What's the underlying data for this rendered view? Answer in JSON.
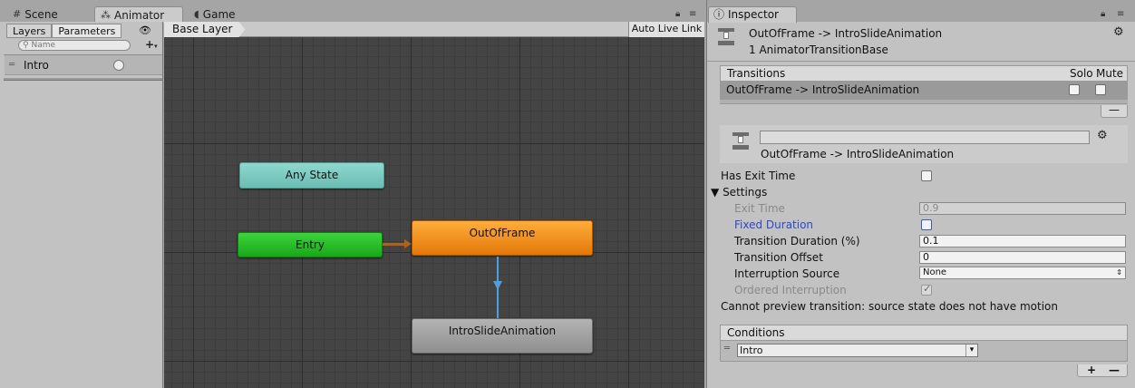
{
  "left_window": {
    "tabs": [
      {
        "label": "Scene",
        "icon": "grid-icon"
      },
      {
        "label": "Animator",
        "icon": "animator-icon"
      },
      {
        "label": "Game",
        "icon": "pacman-icon"
      }
    ],
    "active_tab": "Animator"
  },
  "params_panel": {
    "tabs": [
      "Layers",
      "Parameters"
    ],
    "selected_tab": "Parameters",
    "search_placeholder": "Name",
    "parameters": [
      {
        "name": "Intro",
        "type": "trigger"
      }
    ]
  },
  "graph": {
    "breadcrumb": "Base Layer",
    "live_link_label": "Auto Live Link",
    "nodes": {
      "any_state": "Any State",
      "entry": "Entry",
      "out_of_frame": "OutOfFrame",
      "intro_slide": "IntroSlideAnimation"
    },
    "colors": {
      "background": "#444444",
      "any_state": "#7ccac0",
      "entry": "#2bbd2b",
      "out_of_frame": "#f08a1c",
      "intro_slide": "#a0a0a0",
      "transition_arrow": "#4f9ee0",
      "entry_arrow": "#b0611a"
    }
  },
  "inspector": {
    "tab_label": "Inspector",
    "header_title": "OutOfFrame -> IntroSlideAnimation",
    "header_subtitle": "1 AnimatorTransitionBase",
    "transitions": {
      "heading": "Transitions",
      "col_solo": "Solo",
      "col_mute": "Mute",
      "rows": [
        {
          "label": "OutOfFrame -> IntroSlideAnimation",
          "solo": false,
          "mute": false
        }
      ],
      "remove_label": "—"
    },
    "transition_name": "OutOfFrame -> IntroSlideAnimation",
    "has_exit_time": {
      "label": "Has Exit Time",
      "checked": false
    },
    "settings": {
      "label": "Settings",
      "exit_time": {
        "label": "Exit Time",
        "value": "0.9"
      },
      "fixed_duration": {
        "label": "Fixed Duration",
        "checked": false
      },
      "transition_duration": {
        "label": "Transition Duration (%)",
        "value": "0.1"
      },
      "transition_offset": {
        "label": "Transition Offset",
        "value": "0"
      },
      "interruption_source": {
        "label": "Interruption Source",
        "value": "None"
      },
      "ordered_interruption": {
        "label": "Ordered Interruption",
        "checked": true
      }
    },
    "preview_message": "Cannot preview transition: source state does not have motion",
    "conditions": {
      "heading": "Conditions",
      "rows": [
        {
          "parameter": "Intro"
        }
      ],
      "add_label": "+",
      "remove_label": "—"
    }
  }
}
